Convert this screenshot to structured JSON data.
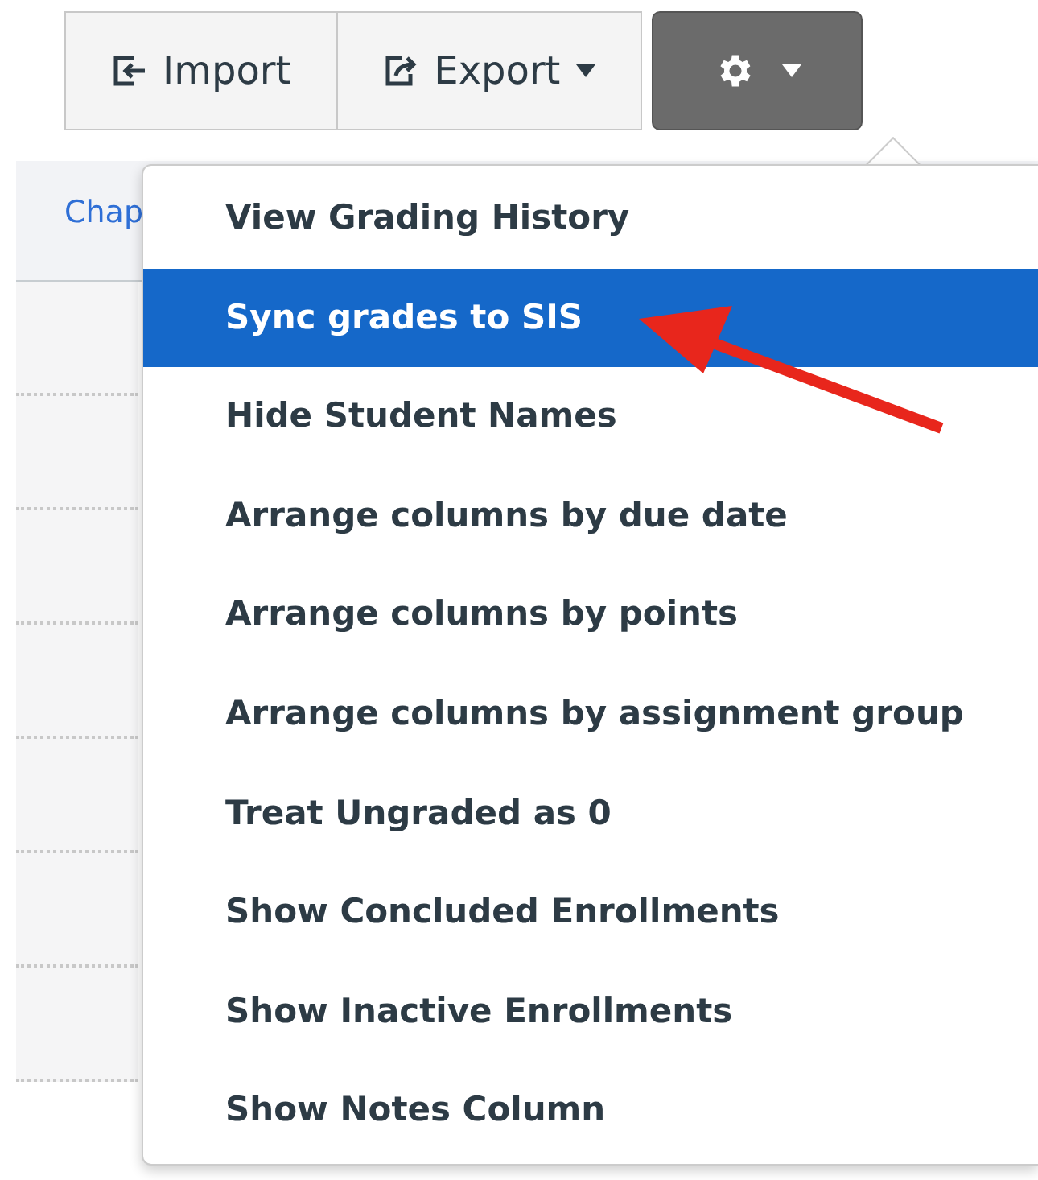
{
  "toolbar": {
    "buttons": [
      {
        "kind": "import",
        "label": "Import"
      },
      {
        "kind": "export",
        "label": "Export",
        "caret": true
      }
    ],
    "settings_button": {
      "caret": true,
      "expanded": true
    }
  },
  "table": {
    "header_link": "Chap"
  },
  "settings_menu": {
    "items": [
      {
        "label": "View Grading History",
        "selected": false
      },
      {
        "label": "Sync grades to SIS",
        "selected": true
      },
      {
        "label": "Hide Student Names",
        "selected": false
      },
      {
        "label": "Arrange columns by due date",
        "selected": false
      },
      {
        "label": "Arrange columns by points",
        "selected": false
      },
      {
        "label": "Arrange columns by assignment group",
        "selected": false
      },
      {
        "label": "Treat Ungraded as 0",
        "selected": false
      },
      {
        "label": "Show Concluded Enrollments",
        "selected": false
      },
      {
        "label": "Show Inactive Enrollments",
        "selected": false
      },
      {
        "label": "Show Notes Column",
        "selected": false
      }
    ]
  }
}
